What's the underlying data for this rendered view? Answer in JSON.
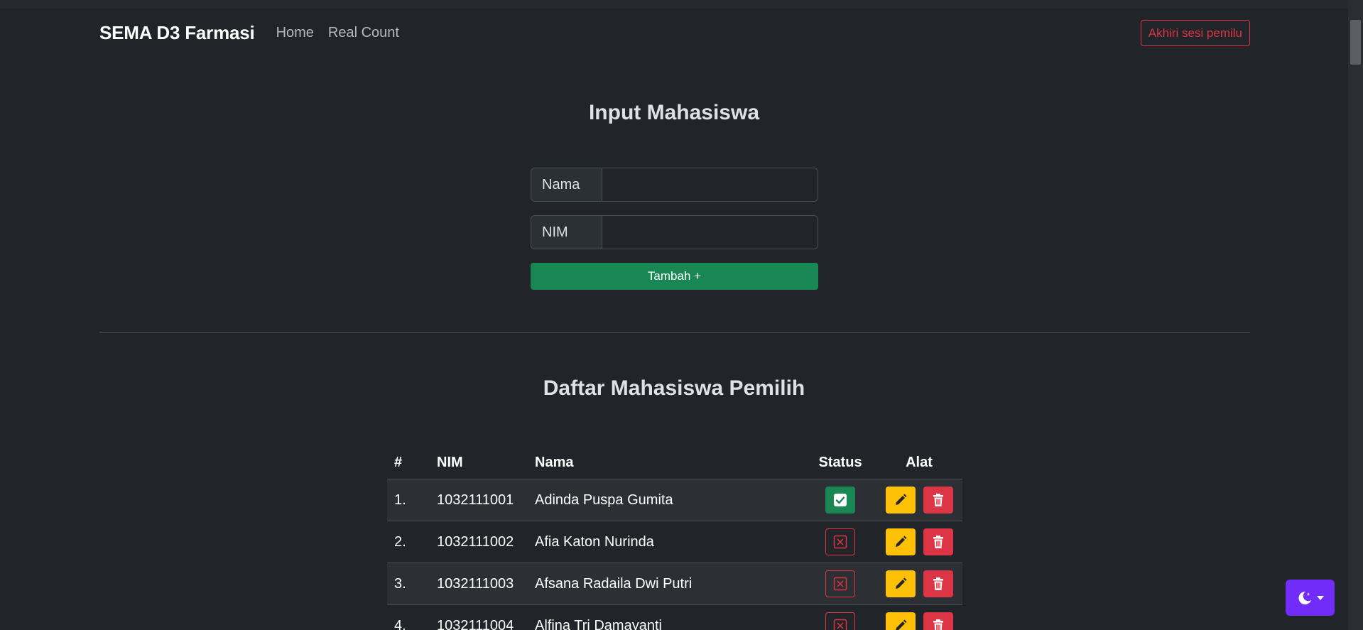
{
  "navbar": {
    "brand": "SEMA D3 Farmasi",
    "links": [
      "Home",
      "Real Count"
    ],
    "end_session": "Akhiri sesi pemilu"
  },
  "form": {
    "title": "Input Mahasiswa",
    "nama_label": "Nama",
    "nama_value": "",
    "nim_label": "NIM",
    "nim_value": "",
    "submit": "Tambah +"
  },
  "list": {
    "title": "Daftar Mahasiswa Pemilih",
    "columns": [
      "#",
      "NIM",
      "Nama",
      "Status",
      "Alat"
    ],
    "rows": [
      {
        "num": "1.",
        "nim": "1032111001",
        "nama": "Adinda Puspa Gumita",
        "status": "voted"
      },
      {
        "num": "2.",
        "nim": "1032111002",
        "nama": "Afia Katon Nurinda",
        "status": "not-voted"
      },
      {
        "num": "3.",
        "nim": "1032111003",
        "nama": "Afsana Radaila Dwi Putri",
        "status": "not-voted"
      },
      {
        "num": "4.",
        "nim": "1032111004",
        "nama": "Alfina Tri Damayanti",
        "status": "not-voted"
      }
    ]
  },
  "icons": {
    "status_voted": "check-square-icon",
    "status_not_voted": "x-square-icon",
    "edit": "pencil-icon",
    "delete": "trash-icon",
    "theme": "moon-stars-icon"
  },
  "colors": {
    "background": "#212529",
    "success": "#198754",
    "danger": "#dc3545",
    "warning": "#ffc107",
    "theme_button": "#712cf9"
  }
}
